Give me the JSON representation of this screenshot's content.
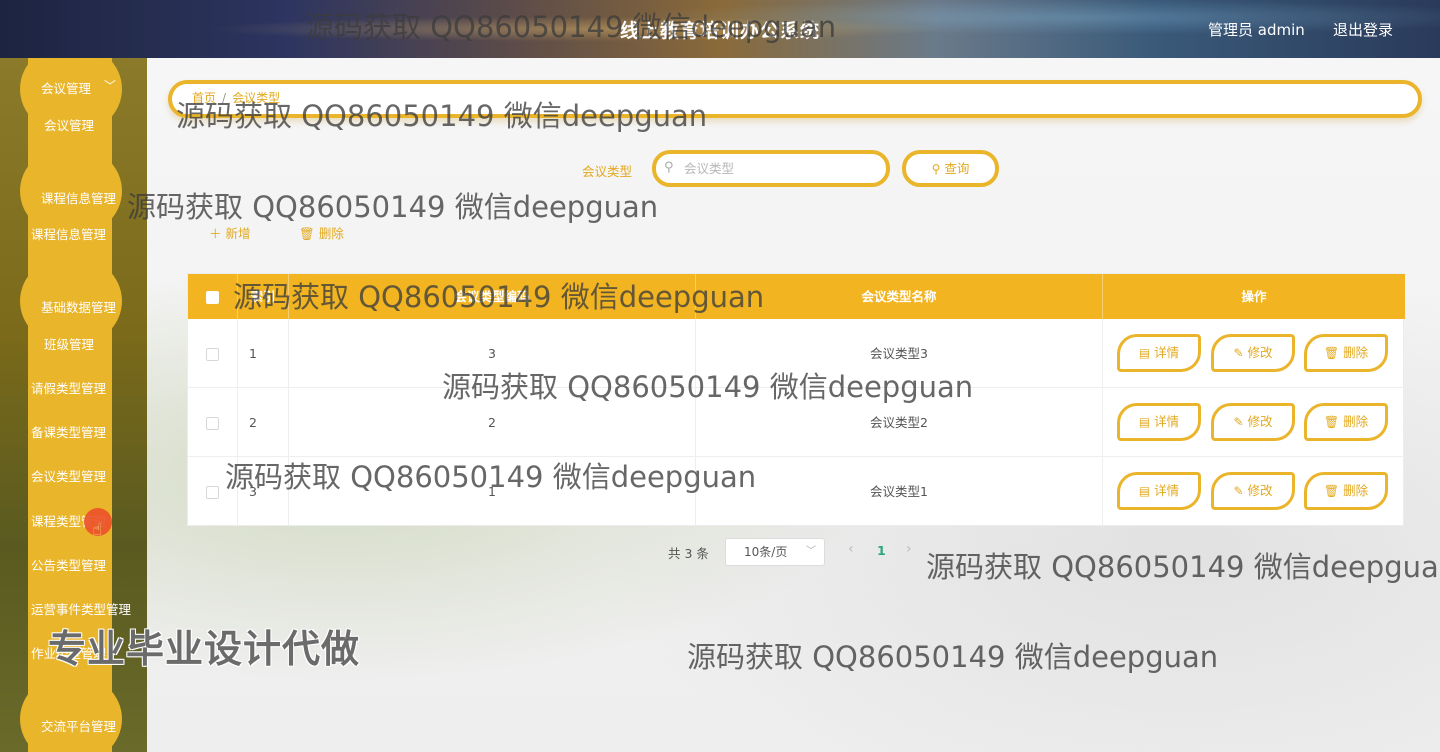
{
  "header": {
    "title": "线上教育培训办公系统",
    "user": "管理员 admin",
    "logout": "退出登录"
  },
  "sidebar": {
    "groups": [
      {
        "label": "会议管理",
        "items": [
          "会议管理"
        ]
      },
      {
        "label": "课程信息管理",
        "items": [
          "课程信息管理"
        ]
      },
      {
        "label": "基础数据管理",
        "items": [
          "班级管理",
          "请假类型管理",
          "备课类型管理",
          "会议类型管理",
          "课程类型管理",
          "公告类型管理",
          "运营事件类型管理",
          "作业类型管理"
        ]
      },
      {
        "label": "交流平台管理",
        "items": []
      }
    ]
  },
  "breadcrumb": {
    "home": "首页",
    "sep": "/",
    "current": "会议类型"
  },
  "search": {
    "label": "会议类型",
    "placeholder": "会议类型",
    "button": "查询"
  },
  "toolbar": {
    "add": "新增",
    "delete": "删除"
  },
  "table": {
    "columns": [
      "索引",
      "会议类型编码",
      "会议类型名称",
      "操作"
    ],
    "rows": [
      {
        "index": "1",
        "code": "3",
        "name": "会议类型3"
      },
      {
        "index": "2",
        "code": "2",
        "name": "会议类型2"
      },
      {
        "index": "3",
        "code": "1",
        "name": "会议类型1"
      }
    ],
    "actions": {
      "detail": "详情",
      "edit": "修改",
      "delete": "删除"
    }
  },
  "pagination": {
    "total": "共 3 条",
    "page_size": "10条/页",
    "current_page": "1"
  },
  "watermarks": {
    "text": "源码获取 QQ86050149 微信deepguan",
    "text_cut": "源码获取 QQ86050149 微信deepgua",
    "banner": "专业毕业设计代做"
  },
  "colors": {
    "accent": "#eab42b",
    "table_header": "#f2b421",
    "page_active": "#2aa87a"
  }
}
